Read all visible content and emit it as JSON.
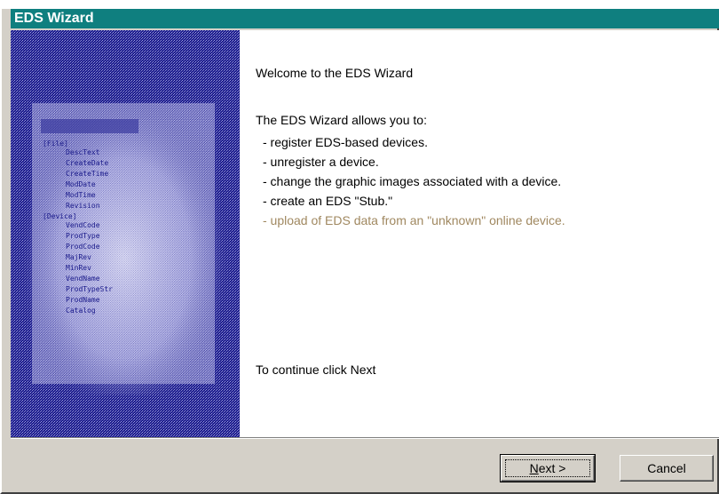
{
  "window": {
    "title": "EDS Wizard"
  },
  "welcome": {
    "heading": "Welcome to the EDS Wizard",
    "intro": "The EDS Wizard allows you to:",
    "items": [
      {
        "text": "- register EDS-based devices.",
        "disabled": false
      },
      {
        "text": "- unregister a device.",
        "disabled": false
      },
      {
        "text": "- change the graphic images associated with a device.",
        "disabled": false
      },
      {
        "text": "- create an EDS \"Stub.\"",
        "disabled": false
      },
      {
        "text": "- upload of EDS data from an \"unknown\" online device.",
        "disabled": true
      }
    ],
    "continue_text": "To continue click Next"
  },
  "buttons": {
    "next_mnemonic": "N",
    "next_rest": "ext >",
    "cancel": "Cancel"
  },
  "colors": {
    "titlebar": "#0f7f7f",
    "panel": "#1a1a8a",
    "disabled_text": "#a08860"
  },
  "illustration": {
    "rows": [
      "DescText",
      "CreateDate",
      "CreateTime",
      "ModDate",
      "ModTime",
      "Revision",
      "VendCode",
      "ProdType",
      "ProdCode",
      "MajRev",
      "MinRev",
      "VendName",
      "ProdTypeStr",
      "ProdName",
      "Catalog"
    ],
    "sections": [
      "[File]",
      "[Device]"
    ]
  }
}
